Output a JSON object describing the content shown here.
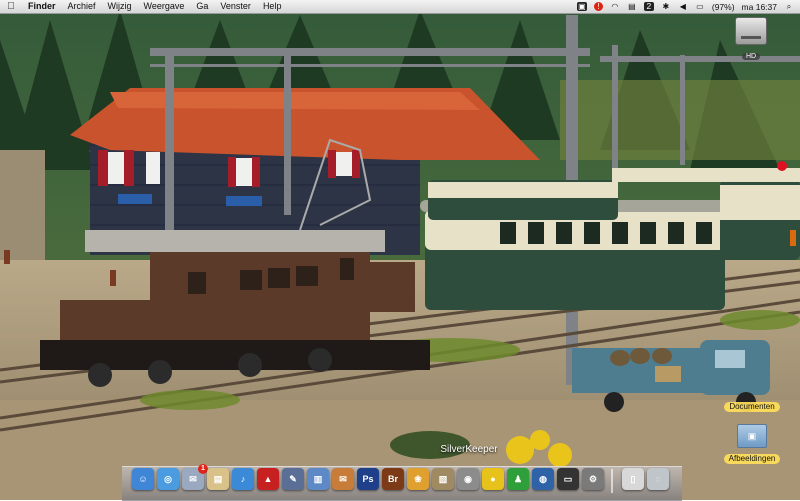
{
  "menubar": {
    "apple_icon": "apple-logo",
    "app_name": "Finder",
    "menus": [
      "Archief",
      "Wijzig",
      "Weergave",
      "Ga",
      "Venster",
      "Help"
    ],
    "extras": {
      "battery": "(97%)",
      "clock": "ma 16:37",
      "input_indicator": "2",
      "icons": [
        "scripts-icon",
        "alert-icon",
        "wifi-icon",
        "spaces-icon",
        "bluetooth-icon",
        "volume-icon",
        "battery-icon",
        "spotlight-icon"
      ]
    }
  },
  "desktop": {
    "hd_label": "HD",
    "documents_label": "Documenten",
    "pictures_label": "Afbeeldingen"
  },
  "dock": {
    "tooltip": "SilverKeeper",
    "items": [
      {
        "name": "finder",
        "color": "#3f86d6",
        "glyph": "☺"
      },
      {
        "name": "safari",
        "color": "#4a9be0",
        "glyph": "◎"
      },
      {
        "name": "mail",
        "color": "#9aa9c0",
        "glyph": "✉",
        "badge": "1"
      },
      {
        "name": "ical",
        "color": "#d9c28a",
        "glyph": "▤"
      },
      {
        "name": "itunes",
        "color": "#3a8ad8",
        "glyph": "♪"
      },
      {
        "name": "red-app",
        "color": "#c72020",
        "glyph": "▲"
      },
      {
        "name": "pen-app",
        "color": "#5b6e96",
        "glyph": "✎"
      },
      {
        "name": "chart-app",
        "color": "#5d8ac6",
        "glyph": "▥"
      },
      {
        "name": "mail-stamp",
        "color": "#c87c3a",
        "glyph": "✉"
      },
      {
        "name": "photoshop",
        "color": "#1f3f8a",
        "glyph": "Ps"
      },
      {
        "name": "bridge",
        "color": "#7c3b16",
        "glyph": "Br"
      },
      {
        "name": "iphoto",
        "color": "#e0a030",
        "glyph": "❀"
      },
      {
        "name": "preview",
        "color": "#a08a62",
        "glyph": "▧"
      },
      {
        "name": "disk-utility",
        "color": "#8c8c8c",
        "glyph": "◉"
      },
      {
        "name": "silverkeeper",
        "color": "#e6c21a",
        "glyph": "●"
      },
      {
        "name": "green-app",
        "color": "#2f9f3a",
        "glyph": "♟"
      },
      {
        "name": "globe-app",
        "color": "#2e63a8",
        "glyph": "◍"
      },
      {
        "name": "terminal",
        "color": "#333333",
        "glyph": "▭"
      },
      {
        "name": "system-preferences",
        "color": "#7a7a7a",
        "glyph": "⚙"
      }
    ],
    "right_items": [
      {
        "name": "documents-stack",
        "color": "#d8d8d8",
        "glyph": "▯"
      },
      {
        "name": "trash",
        "color": "#bfc5c9",
        "glyph": "◌"
      }
    ]
  },
  "colors": {
    "menubar": "#e3e3e3",
    "label_highlight": "#ffde5a"
  }
}
